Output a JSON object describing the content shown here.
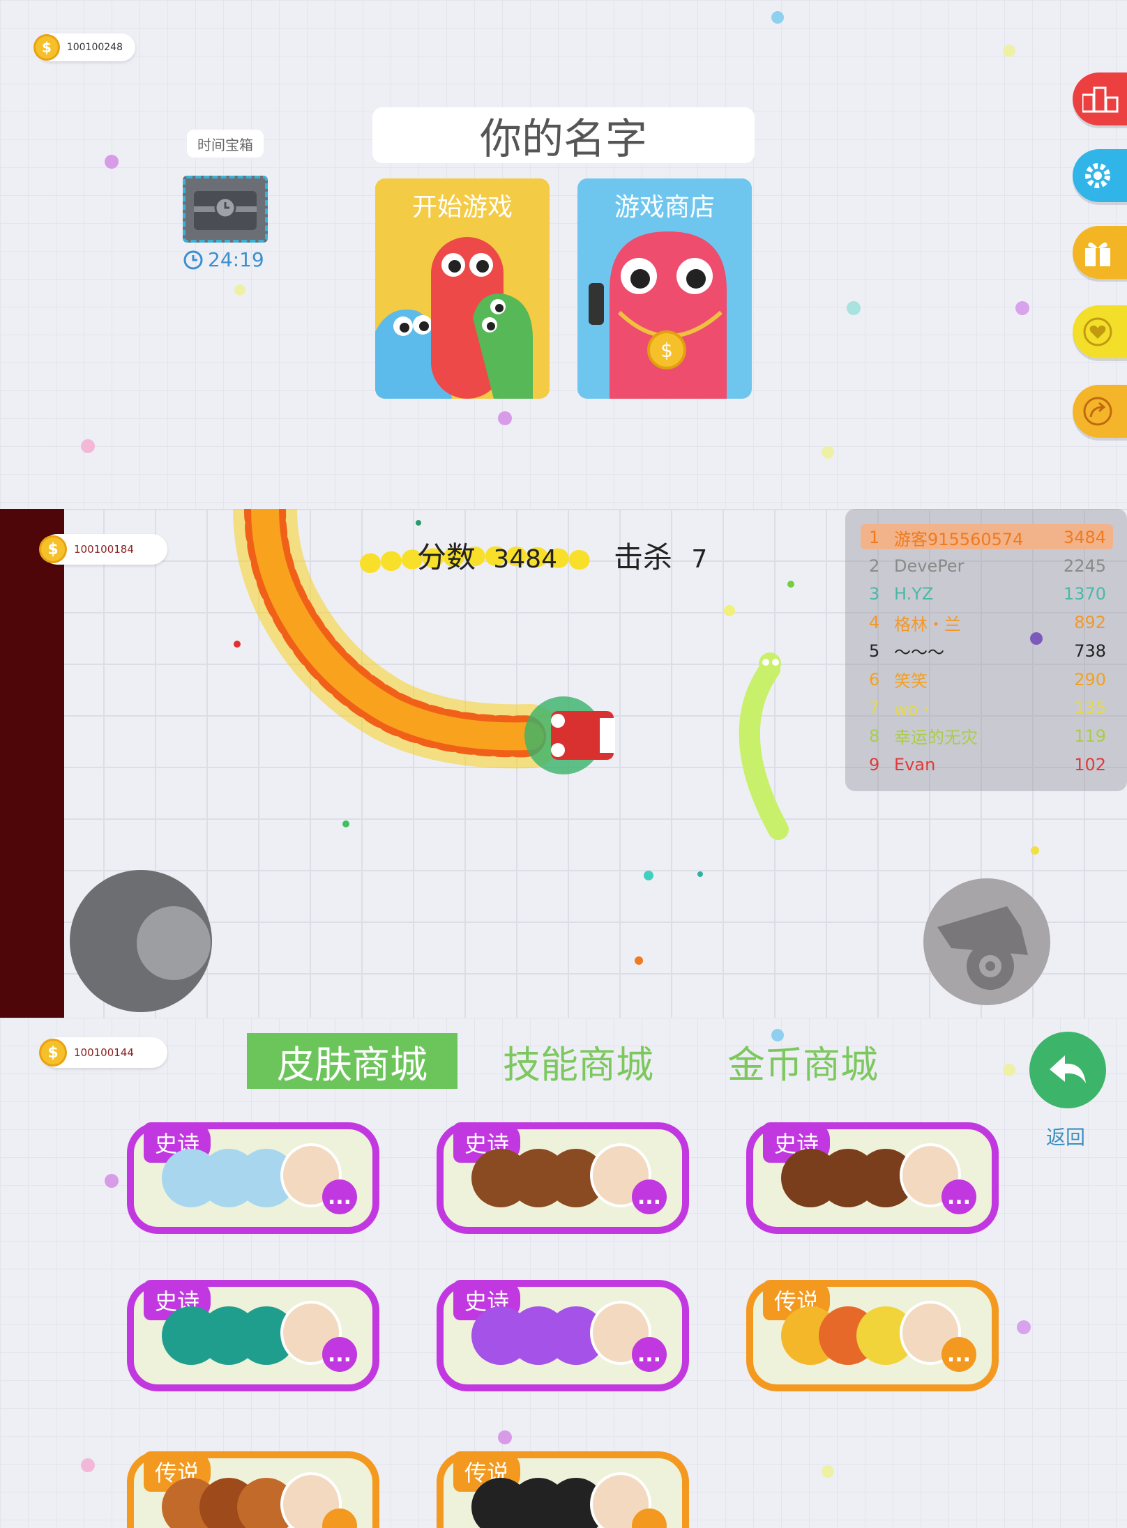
{
  "panel1": {
    "coins": "100100248",
    "name_placeholder": "你的名字",
    "start_game": "开始游戏",
    "game_shop": "游戏商店",
    "chest_tip": "时间宝箱",
    "chest_timer": "24:19",
    "side_buttons": [
      "leaderboard-icon",
      "settings-icon",
      "gift-icon",
      "heart-icon",
      "share-icon"
    ]
  },
  "panel2": {
    "coins": "100100184",
    "score_label": "分数",
    "score_value": "3484",
    "kills_label": "击杀",
    "kills_value": "7",
    "leaderboard": [
      {
        "rank": "1",
        "name": "游客915560574",
        "score": "3484",
        "color": "#f07a1d"
      },
      {
        "rank": "2",
        "name": "DevePer",
        "score": "2245",
        "color": "#8a8a8a"
      },
      {
        "rank": "3",
        "name": "H.YZ",
        "score": "1370",
        "color": "#4bb7a8"
      },
      {
        "rank": "4",
        "name": "格林・兰",
        "score": "892",
        "color": "#f2972a"
      },
      {
        "rank": "5",
        "name": "〜〜〜",
        "score": "738",
        "color": "#222222"
      },
      {
        "rank": "6",
        "name": "笑笑",
        "score": "290",
        "color": "#f2a020"
      },
      {
        "rank": "7",
        "name": "wo・",
        "score": "135",
        "color": "#e6d84a"
      },
      {
        "rank": "8",
        "name": "幸运的无灾",
        "score": "119",
        "color": "#a9cc4a"
      },
      {
        "rank": "9",
        "name": "Evan",
        "score": "102",
        "color": "#e03a3a"
      }
    ]
  },
  "panel3": {
    "coins": "100100144",
    "tabs": [
      {
        "label": "皮肤商城",
        "active": true
      },
      {
        "label": "技能商城",
        "active": false
      },
      {
        "label": "金币商城",
        "active": false
      }
    ],
    "back_label": "返回",
    "skins": [
      {
        "tier": "史诗",
        "kind": "epic",
        "more": "..."
      },
      {
        "tier": "史诗",
        "kind": "epic",
        "more": "..."
      },
      {
        "tier": "史诗",
        "kind": "epic",
        "more": "..."
      },
      {
        "tier": "史诗",
        "kind": "epic",
        "more": "..."
      },
      {
        "tier": "史诗",
        "kind": "epic",
        "more": "..."
      },
      {
        "tier": "传说",
        "kind": "legend",
        "more": "..."
      },
      {
        "tier": "传说",
        "kind": "legend",
        "more": "..."
      },
      {
        "tier": "传说",
        "kind": "legend",
        "more": "..."
      }
    ]
  }
}
